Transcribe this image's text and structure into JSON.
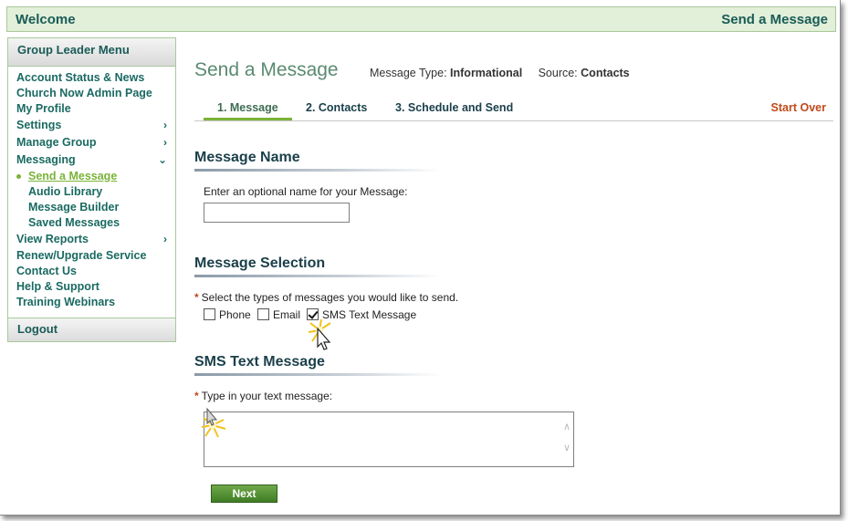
{
  "header": {
    "welcome": "Welcome",
    "page_name": "Send a Message"
  },
  "sidebar": {
    "title": "Group Leader Menu",
    "items": [
      {
        "label": "Account Status & News"
      },
      {
        "label": "Church Now Admin Page"
      },
      {
        "label": "My Profile"
      },
      {
        "label": "Settings",
        "arrow": ">"
      },
      {
        "label": "Manage Group",
        "arrow": ">"
      },
      {
        "label": "Messaging",
        "arrow": "v"
      },
      {
        "label": "Send a Message"
      },
      {
        "label": "Audio Library"
      },
      {
        "label": "Message Builder"
      },
      {
        "label": "Saved Messages"
      },
      {
        "label": "View Reports",
        "arrow": ">"
      },
      {
        "label": "Renew/Upgrade Service"
      },
      {
        "label": "Contact Us"
      },
      {
        "label": "Help & Support"
      },
      {
        "label": "Training Webinars"
      }
    ],
    "logout": "Logout"
  },
  "main": {
    "title": "Send a Message",
    "message_type_label": "Message Type:",
    "message_type_value": "Informational",
    "source_label": "Source:",
    "source_value": "Contacts",
    "tabs": [
      {
        "label": "1.  Message"
      },
      {
        "label": "2.  Contacts"
      },
      {
        "label": "3.  Schedule and Send"
      }
    ],
    "start_over": "Start Over",
    "message_name": {
      "heading": "Message Name",
      "prompt": "Enter an optional name for your Message:",
      "value": ""
    },
    "message_selection": {
      "heading": "Message Selection",
      "required_mark": "*",
      "prompt": "Select the types of messages you would like to send.",
      "options": [
        {
          "label": "Phone",
          "checked": false
        },
        {
          "label": "Email",
          "checked": false
        },
        {
          "label": "SMS Text Message",
          "checked": true
        }
      ]
    },
    "sms": {
      "heading": "SMS Text Message",
      "required_mark": "*",
      "prompt": "Type in your text message:",
      "value": ""
    },
    "next_button": "Next"
  },
  "colors": {
    "header_bg": "#e2efd9",
    "accent_green": "#7ab338",
    "title_teal": "#1a5c57",
    "start_over": "#c04a1a",
    "next_button": "#4f8f30"
  }
}
